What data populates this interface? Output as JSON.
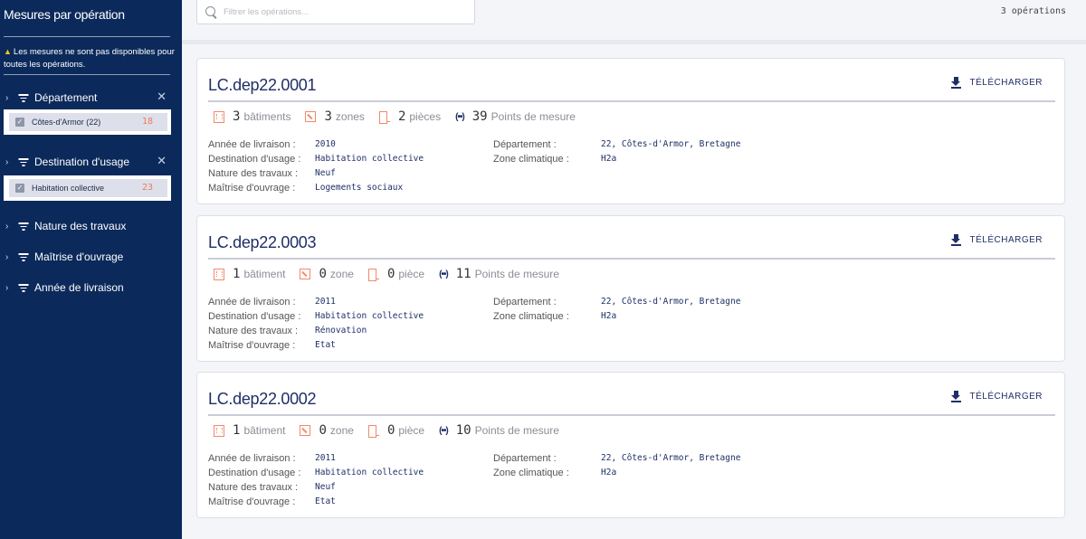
{
  "sidebar": {
    "title": "Mesures par opération",
    "warning": "Les mesures ne sont pas disponibles pour toutes les opérations.",
    "facets": [
      {
        "label": "Département",
        "close": "✕",
        "selected": {
          "label": "Côtes-d'Armor (22)",
          "count": "18"
        }
      },
      {
        "label": "Destination d'usage",
        "close": "✕",
        "selected": {
          "label": "Habitation collective",
          "count": "23"
        }
      },
      {
        "label": "Nature des travaux"
      },
      {
        "label": "Maîtrise d'ouvrage"
      },
      {
        "label": "Année de livraison"
      }
    ]
  },
  "search": {
    "placeholder": "Filtrer les opérations..."
  },
  "op_count": "3 opérations",
  "download_label": "TÉLÉCHARGER",
  "labels": {
    "annee": "Année de livraison :",
    "destination": "Destination d'usage :",
    "nature": "Nature des travaux :",
    "maitrise": "Maîtrise d'ouvrage :",
    "departement": "Département :",
    "zone_climatique": "Zone climatique :"
  },
  "operations": [
    {
      "title": "LC.dep22.0001",
      "stats": {
        "batiments": "3",
        "batiments_label": "bâtiments",
        "zones": "3",
        "zones_label": "zones",
        "pieces": "2",
        "pieces_label": "pièces",
        "points": "39",
        "points_label": "Points de mesure"
      },
      "annee": "2010",
      "destination": "Habitation collective",
      "nature": "Neuf",
      "maitrise": "Logements sociaux",
      "departement": "22, Côtes-d'Armor, Bretagne",
      "zone_climatique": "H2a"
    },
    {
      "title": "LC.dep22.0003",
      "stats": {
        "batiments": "1",
        "batiments_label": "bâtiment",
        "zones": "0",
        "zones_label": "zone",
        "pieces": "0",
        "pieces_label": "pièce",
        "points": "11",
        "points_label": "Points de mesure"
      },
      "annee": "2011",
      "destination": "Habitation collective",
      "nature": "Rénovation",
      "maitrise": "Etat",
      "departement": "22, Côtes-d'Armor, Bretagne",
      "zone_climatique": "H2a"
    },
    {
      "title": "LC.dep22.0002",
      "stats": {
        "batiments": "1",
        "batiments_label": "bâtiment",
        "zones": "0",
        "zones_label": "zone",
        "pieces": "0",
        "pieces_label": "pièce",
        "points": "10",
        "points_label": "Points de mesure"
      },
      "annee": "2011",
      "destination": "Habitation collective",
      "nature": "Neuf",
      "maitrise": "Etat",
      "departement": "22, Côtes-d'Armor, Bretagne",
      "zone_climatique": "H2a"
    }
  ]
}
